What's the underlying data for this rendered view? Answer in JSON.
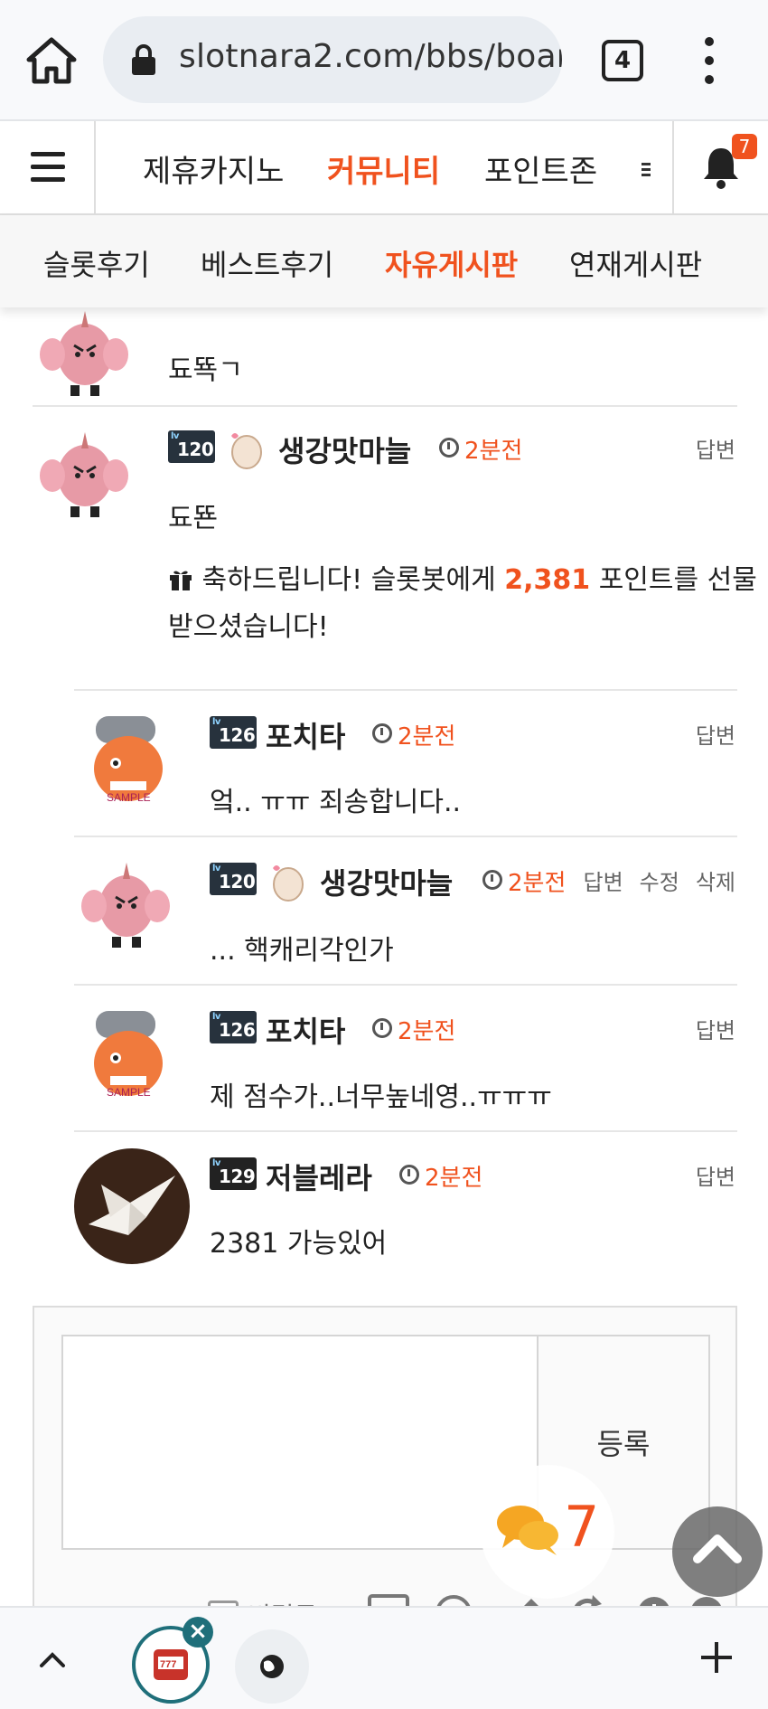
{
  "browser": {
    "url": "slotnara2.com/bbs/boar",
    "tab_count": "4"
  },
  "nav": {
    "items": [
      "제휴카지노",
      "커뮤니티",
      "포인트존"
    ],
    "active_index": 1,
    "notification_count": "7"
  },
  "subnav": {
    "items": [
      "슬롯후기",
      "베스트후기",
      "자유게시판",
      "연재게시판"
    ],
    "active_index": 2
  },
  "comments": [
    {
      "author": "생강맛마늘",
      "time": "2분전",
      "level": "120",
      "text": "됴뚁ㄱ",
      "partial": true
    },
    {
      "author": "생강맛마늘",
      "time": "2분전",
      "level": "120",
      "text": "됴뚄",
      "actions": [
        "답변"
      ],
      "gift": {
        "prefix": "축하드립니다! 슬롯봇에게 ",
        "amount": "2,381",
        "suffix": " 포인트를 선물받으셨습니다!"
      }
    },
    {
      "author": "포치타",
      "time": "2분전",
      "level": "126",
      "text": "엌.. ㅠㅠ 죄송합니다..",
      "actions": [
        "답변"
      ]
    },
    {
      "author": "생강맛마늘",
      "time": "2분전",
      "level": "120",
      "text": "... 핵캐리각인가",
      "actions": [
        "답변",
        "수정",
        "삭제"
      ]
    },
    {
      "author": "포치타",
      "time": "2분전",
      "level": "126",
      "text": "제 점수가..너무높네영..ㅠㅠㅠ",
      "actions": [
        "답변"
      ]
    },
    {
      "author": "저블레라",
      "time": "2분전",
      "level": "129",
      "text": "2381 가능있어",
      "actions": [
        "답변"
      ]
    }
  ],
  "write": {
    "submit_label": "등록",
    "secret_label": "비밀글"
  },
  "chat": {
    "count": "7"
  },
  "colors": {
    "accent": "#f0521e",
    "text": "#222222",
    "muted": "#666666"
  }
}
